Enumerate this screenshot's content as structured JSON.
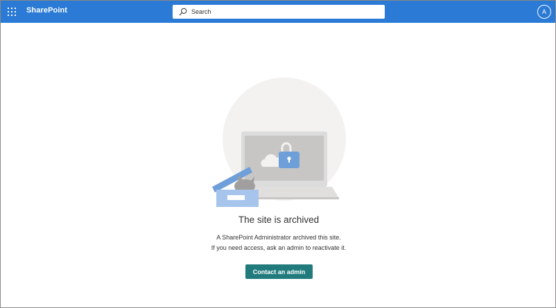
{
  "suitebar": {
    "app_name": "SharePoint",
    "search_placeholder": "Search",
    "avatar_initial": "A",
    "color": "#2b7bd6"
  },
  "icons": [
    "app-launcher-icon",
    "search-icon",
    "archived-site-illustration"
  ],
  "main": {
    "title": "The site is archived",
    "line1": "A SharePoint Administrator archived this site.",
    "line2": "If you need access, ask an admin to reactivate it.",
    "button_label": "Contact an admin",
    "button_color": "#217b7d"
  }
}
